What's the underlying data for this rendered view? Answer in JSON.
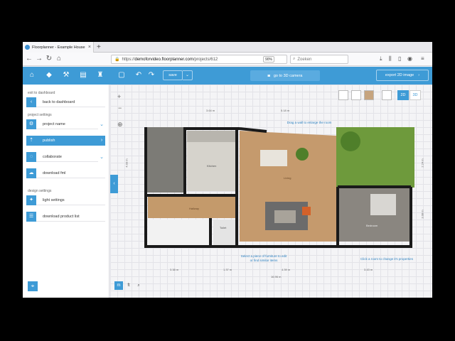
{
  "browser": {
    "tab_title": "Floorplanner - Example House",
    "new_tab": "+",
    "url_prefix": "https://",
    "url_host": "demoforvideo.floorplanner.com",
    "url_path": "/projects/612",
    "zoom": "90%",
    "search_placeholder": "Zoeken"
  },
  "toolbar": {
    "save_label": "save",
    "camera_label": "go to 3D camera",
    "export_label": "export 2D image"
  },
  "sidebar": {
    "exit_label": "exit to dashboard",
    "back_label": "back to dashboard",
    "project_settings_label": "project settings",
    "items": [
      {
        "label": "project name"
      },
      {
        "label": "publish"
      },
      {
        "label": "collaborate"
      },
      {
        "label": "download fml"
      }
    ],
    "design_settings_label": "design settings",
    "design_items": [
      {
        "label": "light settings"
      },
      {
        "label": "download product list"
      }
    ]
  },
  "view": {
    "mode_2d": "2D",
    "mode_3d": "3D",
    "unit_m": "m",
    "unit_ft": "ft"
  },
  "plan": {
    "rooms": {
      "kitchen": "Kitchen",
      "living": "Living",
      "hallway": "Hallway",
      "toilet": "Toilet",
      "bedroom": "Bedroom"
    },
    "hints": {
      "wall": "Drag a wall to enlarge the room",
      "furniture": "Select a piece of furniture to edit or find similar items",
      "room": "Click a room to change it's properties"
    },
    "measures": {
      "top1": "3.64 m",
      "top2": "5.18 m",
      "bottom1": "3.38 m",
      "bottom2": "1.37 m",
      "bottom3": "4.39 m",
      "bottom4": "3.43 m",
      "total": "16.96 m",
      "left": "4.03 m",
      "right1": "2.24 m",
      "right2": "3.08 m"
    }
  },
  "colors": {
    "accent": "#3e9bd6",
    "floor_wood": "#c59a6d",
    "wall": "#1a1a1a",
    "grass": "#6e9a3c"
  }
}
